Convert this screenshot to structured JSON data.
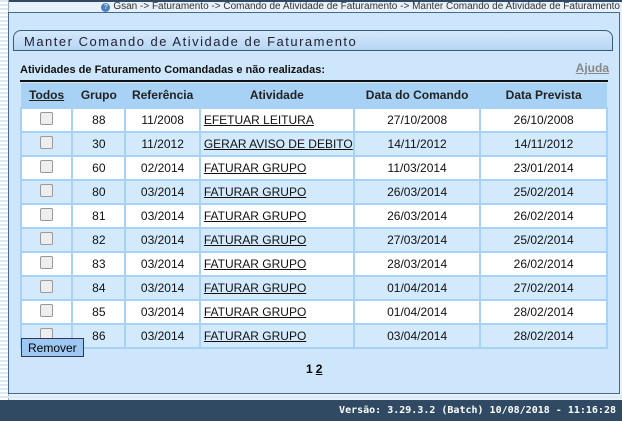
{
  "breadcrumb": "Gsan -> Faturamento -> Comando de Atividade de Faturamento -> Manter Comando de Atividade de Faturamento",
  "title": "Manter Comando de Atividade de Faturamento",
  "subtitle": "Atividades de Faturamento Comandadas e não realizadas:",
  "help": "Ajuda",
  "columns": [
    "Todos",
    "Grupo",
    "Referência",
    "Atividade",
    "Data do Comando",
    "Data Prevista"
  ],
  "rows": [
    [
      "88",
      "11/2008",
      "EFETUAR LEITURA",
      "27/10/2008",
      "26/10/2008"
    ],
    [
      "30",
      "11/2012",
      "GERAR AVISO DE DEBITO",
      "14/11/2012",
      "14/11/2012"
    ],
    [
      "60",
      "02/2014",
      "FATURAR GRUPO",
      "11/03/2014",
      "23/01/2014"
    ],
    [
      "80",
      "03/2014",
      "FATURAR GRUPO",
      "26/03/2014",
      "25/02/2014"
    ],
    [
      "81",
      "03/2014",
      "FATURAR GRUPO",
      "26/03/2014",
      "26/02/2014"
    ],
    [
      "82",
      "03/2014",
      "FATURAR GRUPO",
      "27/03/2014",
      "25/02/2014"
    ],
    [
      "83",
      "03/2014",
      "FATURAR GRUPO",
      "28/03/2014",
      "26/02/2014"
    ],
    [
      "84",
      "03/2014",
      "FATURAR GRUPO",
      "01/04/2014",
      "27/02/2014"
    ],
    [
      "85",
      "03/2014",
      "FATURAR GRUPO",
      "01/04/2014",
      "28/02/2014"
    ],
    [
      "86",
      "03/2014",
      "FATURAR GRUPO",
      "03/04/2014",
      "28/02/2014"
    ]
  ],
  "remove_label": "Remover",
  "pages": [
    "1",
    "2"
  ],
  "footer": "Versão: 3.29.3.2 (Batch) 10/08/2018 - 11:16:28"
}
